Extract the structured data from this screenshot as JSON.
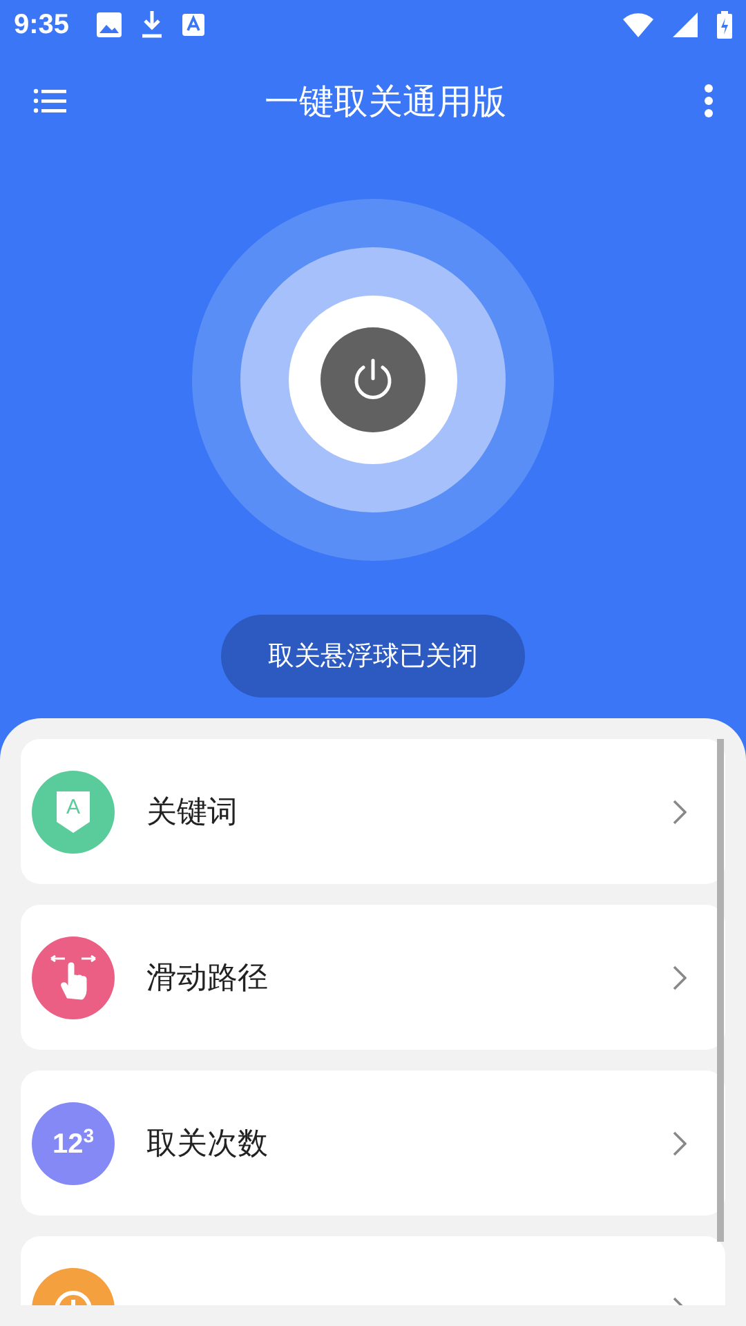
{
  "status_bar": {
    "time": "9:35"
  },
  "toolbar": {
    "title": "一键取关通用版"
  },
  "float_status": {
    "label": "取关悬浮球已关闭",
    "on": false
  },
  "menu": [
    {
      "kind": "keyword",
      "label": "关键词",
      "color": "#5acb9a",
      "icon_text": "A"
    },
    {
      "kind": "swipe",
      "label": "滑动路径",
      "color": "#ec5f85"
    },
    {
      "kind": "count",
      "label": "取关次数",
      "color": "#8489f5",
      "icon_text": "12$^{3}$"
    },
    {
      "kind": "history",
      "color": "#f4a03f"
    }
  ]
}
